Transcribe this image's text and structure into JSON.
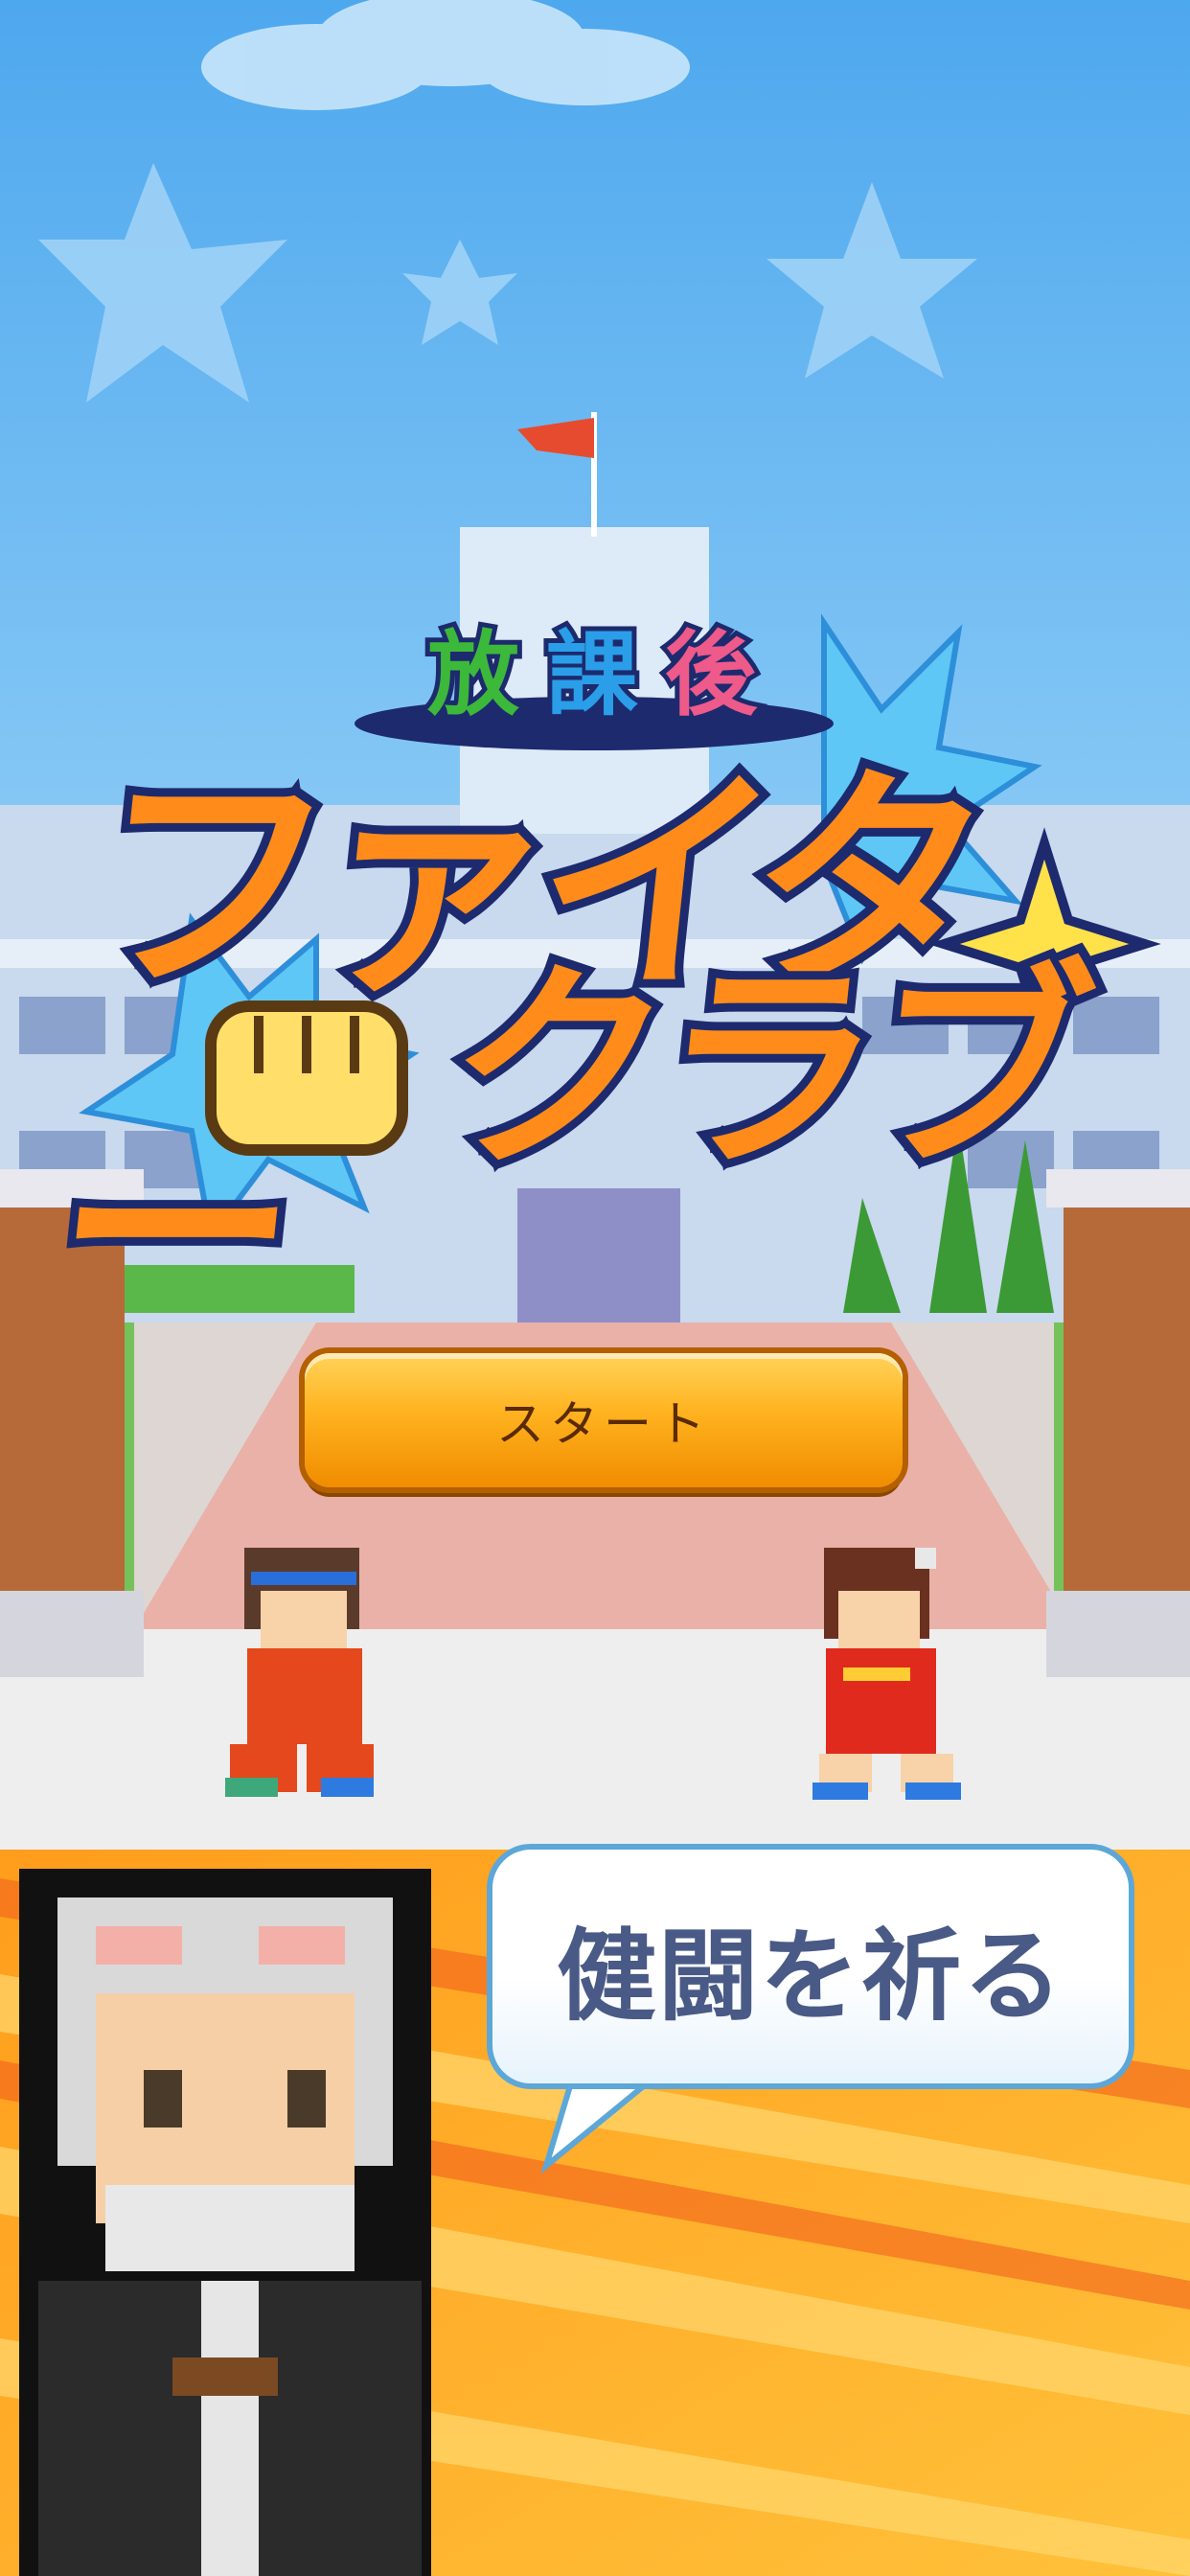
{
  "logo": {
    "top_chars": [
      "放",
      "課",
      "後"
    ],
    "top_colors": [
      "#3cb83a",
      "#2a9ee8",
      "#ee5a8a"
    ],
    "line1": "ファイター",
    "line2": "クラブ"
  },
  "start_button": {
    "label": "スタート"
  },
  "speech": {
    "text": "健闘を祈る"
  },
  "colors": {
    "sky": "#66b4f0",
    "logo_fill": "#ff8c1a",
    "logo_outline": "#1d2a6e",
    "button": "#ffb21f",
    "bubble_text": "#4a5a86"
  }
}
